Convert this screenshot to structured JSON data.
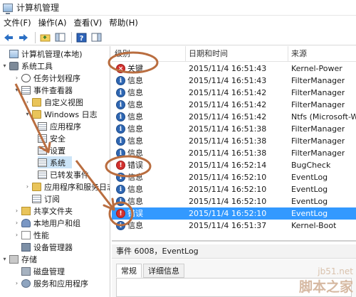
{
  "window": {
    "title": "计算机管理"
  },
  "menu": {
    "items": [
      "文件(F)",
      "操作(A)",
      "查看(V)",
      "帮助(H)"
    ]
  },
  "tree": {
    "items": [
      {
        "label": "计算机管理(本地)",
        "caret": "",
        "icon": "computer-icon"
      },
      {
        "label": "系统工具",
        "caret": "▾",
        "icon": "tools-icon"
      },
      {
        "label": "任务计划程序",
        "caret": "›",
        "icon": "clock-icon"
      },
      {
        "label": "事件查看器",
        "caret": "▾",
        "icon": "event-viewer-icon"
      },
      {
        "label": "自定义视图",
        "caret": "›",
        "icon": "folder-icon"
      },
      {
        "label": "Windows 日志",
        "caret": "▾",
        "icon": "folder-icon"
      },
      {
        "label": "应用程序",
        "caret": "",
        "icon": "log-icon"
      },
      {
        "label": "安全",
        "caret": "",
        "icon": "log-icon"
      },
      {
        "label": "设置",
        "caret": "",
        "icon": "log-icon"
      },
      {
        "label": "系统",
        "caret": "",
        "icon": "log-icon"
      },
      {
        "label": "已转发事件",
        "caret": "",
        "icon": "log-icon"
      },
      {
        "label": "应用程序和服务日志",
        "caret": "›",
        "icon": "folder-icon"
      },
      {
        "label": "订阅",
        "caret": "",
        "icon": "subscription-icon"
      },
      {
        "label": "共享文件夹",
        "caret": "›",
        "icon": "shared-folder-icon"
      },
      {
        "label": "本地用户和组",
        "caret": "›",
        "icon": "users-icon"
      },
      {
        "label": "性能",
        "caret": "›",
        "icon": "performance-icon"
      },
      {
        "label": "设备管理器",
        "caret": "",
        "icon": "device-manager-icon"
      },
      {
        "label": "存储",
        "caret": "▾",
        "icon": "storage-icon"
      },
      {
        "label": "磁盘管理",
        "caret": "",
        "icon": "disk-icon"
      },
      {
        "label": "服务和应用程序",
        "caret": "›",
        "icon": "services-icon"
      }
    ]
  },
  "list": {
    "columns": [
      "级别",
      "日期和时间",
      "来源"
    ],
    "rows": [
      {
        "level": "关键",
        "type": "critical",
        "datetime": "2015/11/4 16:51:43",
        "source": "Kernel-Power"
      },
      {
        "level": "信息",
        "type": "info",
        "datetime": "2015/11/4 16:51:43",
        "source": "FilterManager"
      },
      {
        "level": "信息",
        "type": "info",
        "datetime": "2015/11/4 16:51:42",
        "source": "FilterManager"
      },
      {
        "level": "信息",
        "type": "info",
        "datetime": "2015/11/4 16:51:42",
        "source": "FilterManager"
      },
      {
        "level": "信息",
        "type": "info",
        "datetime": "2015/11/4 16:51:42",
        "source": "Ntfs (Microsoft-W"
      },
      {
        "level": "信息",
        "type": "info",
        "datetime": "2015/11/4 16:51:38",
        "source": "FilterManager"
      },
      {
        "level": "信息",
        "type": "info",
        "datetime": "2015/11/4 16:51:38",
        "source": "FilterManager"
      },
      {
        "level": "信息",
        "type": "info",
        "datetime": "2015/11/4 16:51:38",
        "source": "FilterManager"
      },
      {
        "level": "错误",
        "type": "error",
        "datetime": "2015/11/4 16:52:14",
        "source": "BugCheck"
      },
      {
        "level": "信息",
        "type": "info",
        "datetime": "2015/11/4 16:52:10",
        "source": "EventLog"
      },
      {
        "level": "信息",
        "type": "info",
        "datetime": "2015/11/4 16:52:10",
        "source": "EventLog"
      },
      {
        "level": "信息",
        "type": "info",
        "datetime": "2015/11/4 16:52:10",
        "source": "EventLog"
      },
      {
        "level": "错误",
        "type": "error",
        "datetime": "2015/11/4 16:52:10",
        "source": "EventLog"
      },
      {
        "level": "信息",
        "type": "info",
        "datetime": "2015/11/4 16:51:37",
        "source": "Kernel-Boot"
      }
    ]
  },
  "detail": {
    "title": "事件 6008，EventLog",
    "tabs": [
      "常规",
      "详细信息"
    ]
  },
  "watermark": {
    "url": "jb51.net",
    "text": "脚本之家"
  },
  "colors": {
    "selection": "#3399ff",
    "tree_selection": "#cce4f7",
    "annotation": "#b96d3f"
  }
}
